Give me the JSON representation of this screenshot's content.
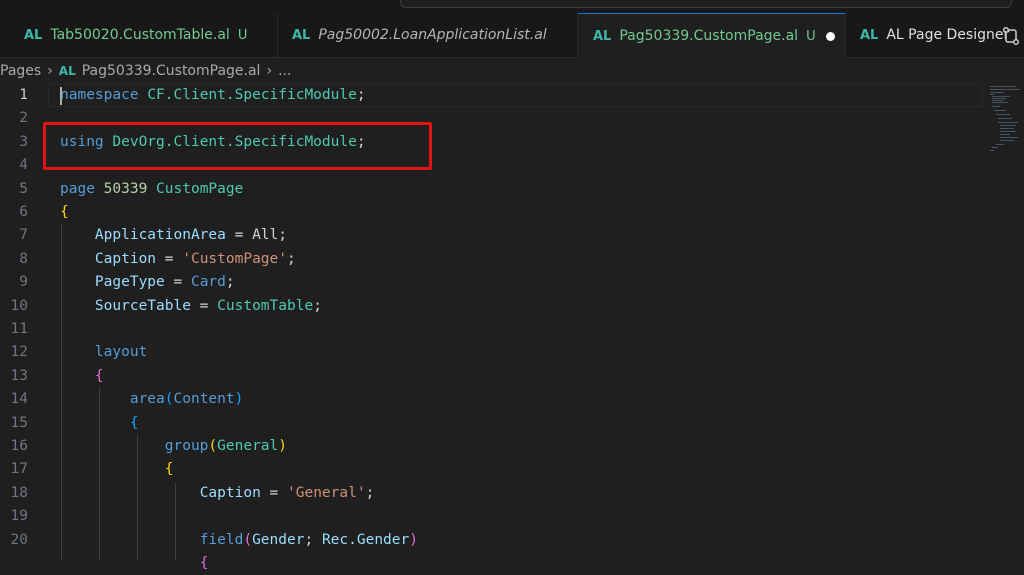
{
  "tabs": [
    {
      "icon": "AL",
      "name": "Tab50020.CustomTable.al",
      "status": "U"
    },
    {
      "icon": "AL",
      "name": "Pag50002.LoanApplicationList.al"
    },
    {
      "icon": "AL",
      "name": "Pag50339.CustomPage.al",
      "status": "U",
      "modified": true
    },
    {
      "icon": "AL",
      "name": "AL Page Designer"
    }
  ],
  "breadcrumb": {
    "folder": "Pages",
    "file_icon": "AL",
    "file": "Pag50339.CustomPage.al",
    "tail": "..."
  },
  "editor": {
    "line_numbers": [
      "1",
      "2",
      "3",
      "4",
      "5",
      "6",
      "7",
      "8",
      "9",
      "10",
      "11",
      "12",
      "13",
      "14",
      "15",
      "16",
      "17",
      "18",
      "19",
      "20"
    ],
    "lines": {
      "l1_kw": "namespace",
      "l1_ns": "CF.Client.SpecificModule",
      "l1_end": ";",
      "l3_kw": "using",
      "l3_ns": "DevOrg.Client.SpecificModule",
      "l3_end": ";",
      "l5_kw": "page",
      "l5_num": "50339",
      "l5_name": "CustomPage",
      "l6": "{",
      "l7_prop": "ApplicationArea",
      "l7_eq": " = ",
      "l7_val": "All",
      "l7_end": ";",
      "l8_prop": "Caption",
      "l8_eq": " = ",
      "l8_val": "'CustomPage'",
      "l8_end": ";",
      "l9_prop": "PageType",
      "l9_eq": " = ",
      "l9_val": "Card",
      "l9_end": ";",
      "l10_prop": "SourceTable",
      "l10_eq": " = ",
      "l10_val": "CustomTable",
      "l10_end": ";",
      "l12_kw": "layout",
      "l13": "{",
      "l14_kw": "area",
      "l14_open": "(",
      "l14_arg": "Content",
      "l14_close": ")",
      "l15": "{",
      "l16_kw": "group",
      "l16_open": "(",
      "l16_arg": "General",
      "l16_close": ")",
      "l17": "{",
      "l18_prop": "Caption",
      "l18_eq": " = ",
      "l18_val": "'General'",
      "l18_end": ";",
      "l20_kw": "field",
      "l20_open": "(",
      "l20_arg1": "Gender",
      "l20_sep": "; ",
      "l20_arg2": "Rec.Gender",
      "l20_close": ")"
    }
  },
  "colors": {
    "accent_tab": "#0078d4",
    "highlight_box": "#e01414",
    "keyword": "#569cd6",
    "type": "#4ec9b0",
    "string": "#ce9178",
    "property": "#9cdcfe"
  }
}
